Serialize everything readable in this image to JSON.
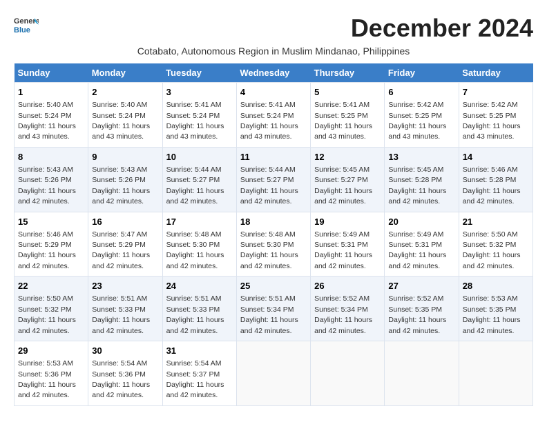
{
  "logo": {
    "line1": "General",
    "line2": "Blue"
  },
  "title": "December 2024",
  "subtitle": "Cotabato, Autonomous Region in Muslim Mindanao, Philippines",
  "days_header": [
    "Sunday",
    "Monday",
    "Tuesday",
    "Wednesday",
    "Thursday",
    "Friday",
    "Saturday"
  ],
  "weeks": [
    [
      {
        "day": "1",
        "sunrise": "5:40 AM",
        "sunset": "5:24 PM",
        "daylight": "11 hours and 43 minutes."
      },
      {
        "day": "2",
        "sunrise": "5:40 AM",
        "sunset": "5:24 PM",
        "daylight": "11 hours and 43 minutes."
      },
      {
        "day": "3",
        "sunrise": "5:41 AM",
        "sunset": "5:24 PM",
        "daylight": "11 hours and 43 minutes."
      },
      {
        "day": "4",
        "sunrise": "5:41 AM",
        "sunset": "5:24 PM",
        "daylight": "11 hours and 43 minutes."
      },
      {
        "day": "5",
        "sunrise": "5:41 AM",
        "sunset": "5:25 PM",
        "daylight": "11 hours and 43 minutes."
      },
      {
        "day": "6",
        "sunrise": "5:42 AM",
        "sunset": "5:25 PM",
        "daylight": "11 hours and 43 minutes."
      },
      {
        "day": "7",
        "sunrise": "5:42 AM",
        "sunset": "5:25 PM",
        "daylight": "11 hours and 43 minutes."
      }
    ],
    [
      {
        "day": "8",
        "sunrise": "5:43 AM",
        "sunset": "5:26 PM",
        "daylight": "11 hours and 42 minutes."
      },
      {
        "day": "9",
        "sunrise": "5:43 AM",
        "sunset": "5:26 PM",
        "daylight": "11 hours and 42 minutes."
      },
      {
        "day": "10",
        "sunrise": "5:44 AM",
        "sunset": "5:27 PM",
        "daylight": "11 hours and 42 minutes."
      },
      {
        "day": "11",
        "sunrise": "5:44 AM",
        "sunset": "5:27 PM",
        "daylight": "11 hours and 42 minutes."
      },
      {
        "day": "12",
        "sunrise": "5:45 AM",
        "sunset": "5:27 PM",
        "daylight": "11 hours and 42 minutes."
      },
      {
        "day": "13",
        "sunrise": "5:45 AM",
        "sunset": "5:28 PM",
        "daylight": "11 hours and 42 minutes."
      },
      {
        "day": "14",
        "sunrise": "5:46 AM",
        "sunset": "5:28 PM",
        "daylight": "11 hours and 42 minutes."
      }
    ],
    [
      {
        "day": "15",
        "sunrise": "5:46 AM",
        "sunset": "5:29 PM",
        "daylight": "11 hours and 42 minutes."
      },
      {
        "day": "16",
        "sunrise": "5:47 AM",
        "sunset": "5:29 PM",
        "daylight": "11 hours and 42 minutes."
      },
      {
        "day": "17",
        "sunrise": "5:48 AM",
        "sunset": "5:30 PM",
        "daylight": "11 hours and 42 minutes."
      },
      {
        "day": "18",
        "sunrise": "5:48 AM",
        "sunset": "5:30 PM",
        "daylight": "11 hours and 42 minutes."
      },
      {
        "day": "19",
        "sunrise": "5:49 AM",
        "sunset": "5:31 PM",
        "daylight": "11 hours and 42 minutes."
      },
      {
        "day": "20",
        "sunrise": "5:49 AM",
        "sunset": "5:31 PM",
        "daylight": "11 hours and 42 minutes."
      },
      {
        "day": "21",
        "sunrise": "5:50 AM",
        "sunset": "5:32 PM",
        "daylight": "11 hours and 42 minutes."
      }
    ],
    [
      {
        "day": "22",
        "sunrise": "5:50 AM",
        "sunset": "5:32 PM",
        "daylight": "11 hours and 42 minutes."
      },
      {
        "day": "23",
        "sunrise": "5:51 AM",
        "sunset": "5:33 PM",
        "daylight": "11 hours and 42 minutes."
      },
      {
        "day": "24",
        "sunrise": "5:51 AM",
        "sunset": "5:33 PM",
        "daylight": "11 hours and 42 minutes."
      },
      {
        "day": "25",
        "sunrise": "5:51 AM",
        "sunset": "5:34 PM",
        "daylight": "11 hours and 42 minutes."
      },
      {
        "day": "26",
        "sunrise": "5:52 AM",
        "sunset": "5:34 PM",
        "daylight": "11 hours and 42 minutes."
      },
      {
        "day": "27",
        "sunrise": "5:52 AM",
        "sunset": "5:35 PM",
        "daylight": "11 hours and 42 minutes."
      },
      {
        "day": "28",
        "sunrise": "5:53 AM",
        "sunset": "5:35 PM",
        "daylight": "11 hours and 42 minutes."
      }
    ],
    [
      {
        "day": "29",
        "sunrise": "5:53 AM",
        "sunset": "5:36 PM",
        "daylight": "11 hours and 42 minutes."
      },
      {
        "day": "30",
        "sunrise": "5:54 AM",
        "sunset": "5:36 PM",
        "daylight": "11 hours and 42 minutes."
      },
      {
        "day": "31",
        "sunrise": "5:54 AM",
        "sunset": "5:37 PM",
        "daylight": "11 hours and 42 minutes."
      },
      null,
      null,
      null,
      null
    ]
  ]
}
